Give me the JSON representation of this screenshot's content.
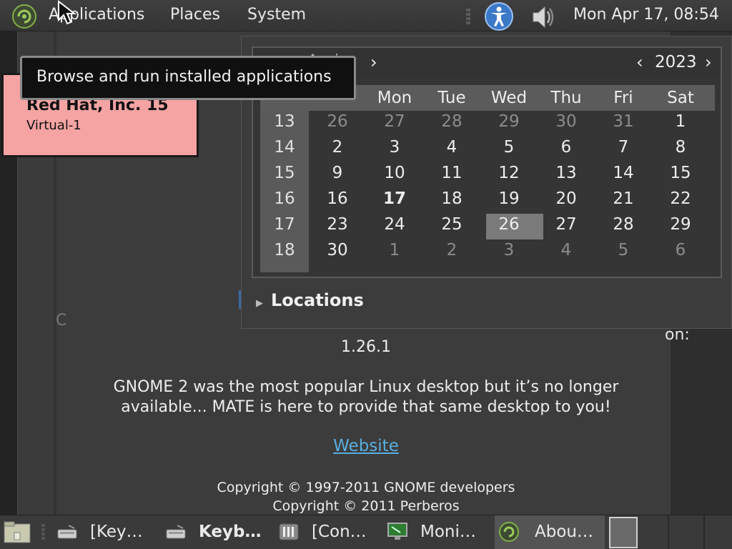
{
  "top_panel": {
    "menus": {
      "applications": "Applications",
      "places": "Places",
      "system": "System"
    },
    "clock": "Mon Apr 17, 08:54"
  },
  "tooltip": {
    "text": "Browse and run installed applications"
  },
  "notification": {
    "title": "Red Hat, Inc. 15",
    "subtitle": "Virtual-1"
  },
  "calendar": {
    "month_partial": "Apri",
    "month_next": "›",
    "year_prev": "‹",
    "year": "2023",
    "year_next": "›",
    "weekdays": [
      "Mon",
      "Tue",
      "Wed",
      "Thu",
      "Fri",
      "Sat"
    ],
    "weeks": [
      {
        "week": "13",
        "days": [
          "26",
          "27",
          "28",
          "29",
          "30",
          "31",
          "1"
        ],
        "dim": [
          true,
          true,
          true,
          true,
          true,
          true,
          false
        ]
      },
      {
        "week": "14",
        "days": [
          "2",
          "3",
          "4",
          "5",
          "6",
          "7",
          "8"
        ],
        "dim": [
          false,
          false,
          false,
          false,
          false,
          false,
          false
        ]
      },
      {
        "week": "15",
        "days": [
          "9",
          "10",
          "11",
          "12",
          "13",
          "14",
          "15"
        ],
        "dim": [
          false,
          false,
          false,
          false,
          false,
          false,
          false
        ]
      },
      {
        "week": "16",
        "days": [
          "16",
          "17",
          "18",
          "19",
          "20",
          "21",
          "22"
        ],
        "dim": [
          false,
          false,
          false,
          false,
          false,
          false,
          false
        ]
      },
      {
        "week": "17",
        "days": [
          "23",
          "24",
          "25",
          "26",
          "27",
          "28",
          "29"
        ],
        "dim": [
          false,
          false,
          false,
          false,
          false,
          false,
          false
        ]
      },
      {
        "week": "18",
        "days": [
          "30",
          "1",
          "2",
          "3",
          "4",
          "5",
          "6"
        ],
        "dim": [
          false,
          true,
          true,
          true,
          true,
          true,
          true
        ]
      }
    ],
    "today": "17",
    "selected": "26",
    "locations_label": "Locations"
  },
  "about": {
    "version": "1.26.1",
    "description_line1": "GNOME 2 was the most popular Linux desktop but it’s no longer",
    "description_line2": "available... MATE is here to provide that same desktop to you!",
    "website_link": "Website",
    "copyright_line1": "Copyright © 1997-2011 GNOME developers",
    "copyright_line2": "Copyright © 2011 Perberos",
    "right_fragment": "on:",
    "left_fragment": "C"
  },
  "taskbar": {
    "tasks": [
      {
        "label": "[Key…",
        "icon": "keyboard-icon",
        "active": false,
        "bold": false
      },
      {
        "label": "Keyb…",
        "icon": "keyboard-icon",
        "active": false,
        "bold": true
      },
      {
        "label": "[Con…",
        "icon": "control-center-icon",
        "active": false,
        "bold": false
      },
      {
        "label": "Moni…",
        "icon": "monitor-icon",
        "active": false,
        "bold": false
      },
      {
        "label": "Abou…",
        "icon": "mate-logo-icon",
        "active": true,
        "bold": false
      }
    ]
  },
  "colors": {
    "panel": "#3a3a3a",
    "link": "#5aaee0",
    "notification": "#f5a3a3",
    "accessibility": "#3b78c8"
  }
}
